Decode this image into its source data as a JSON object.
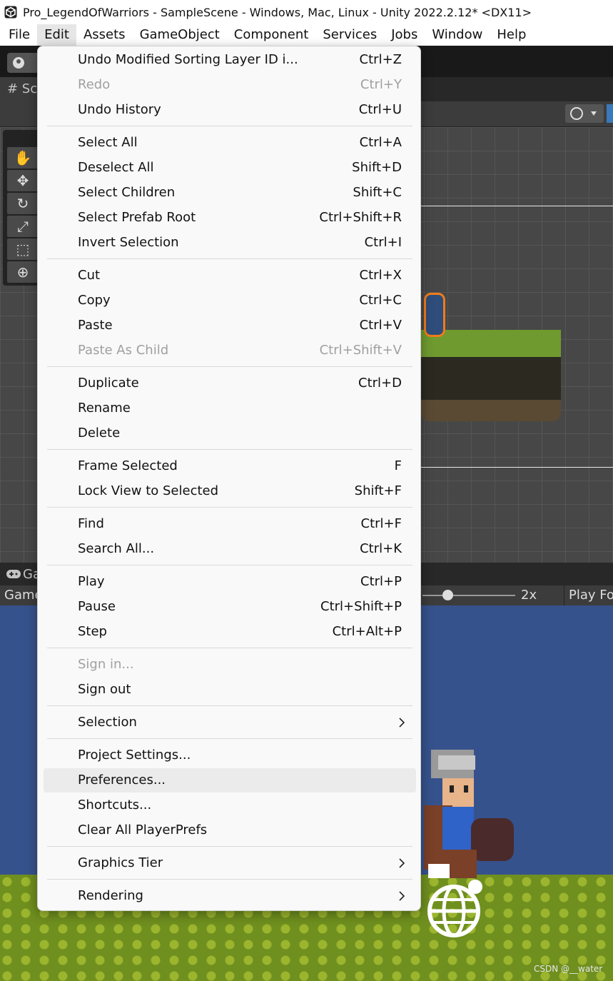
{
  "window": {
    "title": "Pro_LegendOfWarriors - SampleScene - Windows, Mac, Linux - Unity 2022.2.12* <DX11>",
    "app_icon": "unity-logo-icon"
  },
  "menubar": {
    "items": [
      "File",
      "Edit",
      "Assets",
      "GameObject",
      "Component",
      "Services",
      "Jobs",
      "Window",
      "Help"
    ],
    "active": "Edit"
  },
  "editor": {
    "scene_tab": "# Sc",
    "game_tab": "Ga",
    "game_display": "Game",
    "scale_label": "2x",
    "play_focus": "Play Fo"
  },
  "edit_menu": {
    "items": [
      {
        "label": "Undo Modified Sorting Layer ID i...",
        "shortcut": "Ctrl+Z",
        "enabled": true
      },
      {
        "label": "Redo",
        "shortcut": "Ctrl+Y",
        "enabled": false
      },
      {
        "label": "Undo History",
        "shortcut": "Ctrl+U",
        "enabled": true
      },
      {
        "label": "Select All",
        "shortcut": "Ctrl+A",
        "enabled": true
      },
      {
        "label": "Deselect All",
        "shortcut": "Shift+D",
        "enabled": true
      },
      {
        "label": "Select Children",
        "shortcut": "Shift+C",
        "enabled": true
      },
      {
        "label": "Select Prefab Root",
        "shortcut": "Ctrl+Shift+R",
        "enabled": true
      },
      {
        "label": "Invert Selection",
        "shortcut": "Ctrl+I",
        "enabled": true
      },
      {
        "label": "Cut",
        "shortcut": "Ctrl+X",
        "enabled": true
      },
      {
        "label": "Copy",
        "shortcut": "Ctrl+C",
        "enabled": true
      },
      {
        "label": "Paste",
        "shortcut": "Ctrl+V",
        "enabled": true
      },
      {
        "label": "Paste As Child",
        "shortcut": "Ctrl+Shift+V",
        "enabled": false
      },
      {
        "label": "Duplicate",
        "shortcut": "Ctrl+D",
        "enabled": true
      },
      {
        "label": "Rename",
        "shortcut": "",
        "enabled": true
      },
      {
        "label": "Delete",
        "shortcut": "",
        "enabled": true
      },
      {
        "label": "Frame Selected",
        "shortcut": "F",
        "enabled": true
      },
      {
        "label": "Lock View to Selected",
        "shortcut": "Shift+F",
        "enabled": true
      },
      {
        "label": "Find",
        "shortcut": "Ctrl+F",
        "enabled": true
      },
      {
        "label": "Search All...",
        "shortcut": "Ctrl+K",
        "enabled": true
      },
      {
        "label": "Play",
        "shortcut": "Ctrl+P",
        "enabled": true
      },
      {
        "label": "Pause",
        "shortcut": "Ctrl+Shift+P",
        "enabled": true
      },
      {
        "label": "Step",
        "shortcut": "Ctrl+Alt+P",
        "enabled": true
      },
      {
        "label": "Sign in...",
        "shortcut": "",
        "enabled": false
      },
      {
        "label": "Sign out",
        "shortcut": "",
        "enabled": true
      },
      {
        "label": "Selection",
        "shortcut": "",
        "enabled": true,
        "submenu": true
      },
      {
        "label": "Project Settings...",
        "shortcut": "",
        "enabled": true
      },
      {
        "label": "Preferences...",
        "shortcut": "",
        "enabled": true,
        "hover": true
      },
      {
        "label": "Shortcuts...",
        "shortcut": "",
        "enabled": true
      },
      {
        "label": "Clear All PlayerPrefs",
        "shortcut": "",
        "enabled": true
      },
      {
        "label": "Graphics Tier",
        "shortcut": "",
        "enabled": true,
        "submenu": true
      },
      {
        "label": "Rendering",
        "shortcut": "",
        "enabled": true,
        "submenu": true
      }
    ]
  },
  "watermark": "CSDN @__water",
  "colors": {
    "menu_bg": "#f9f9f9",
    "hover_bg": "#ebebeb",
    "disabled_text": "#a0a0a0",
    "game_sky": "#36528c",
    "selection_outline": "#f07c1a"
  }
}
